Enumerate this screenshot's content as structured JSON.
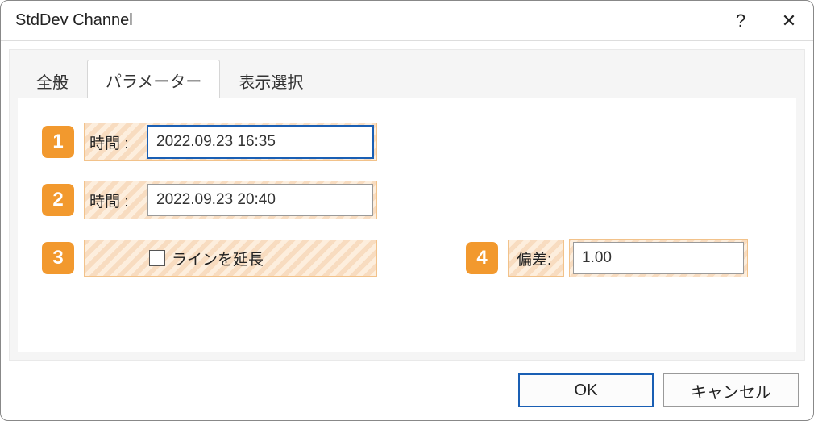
{
  "window": {
    "title": "StdDev Channel",
    "help_glyph": "?",
    "close_glyph": "✕"
  },
  "tabs": {
    "general": "全般",
    "parameters": "パラメーター",
    "display": "表示選択"
  },
  "annotations": {
    "n1": "1",
    "n2": "2",
    "n3": "3",
    "n4": "4"
  },
  "params": {
    "time_label": "時間 :",
    "time1_value": "2022.09.23 16:35",
    "time2_value": "2022.09.23 20:40",
    "extend_label": "ラインを延長",
    "extend_checked": false,
    "deviation_label": "偏差:",
    "deviation_value": "1.00"
  },
  "buttons": {
    "ok": "OK",
    "cancel": "キャンセル"
  }
}
